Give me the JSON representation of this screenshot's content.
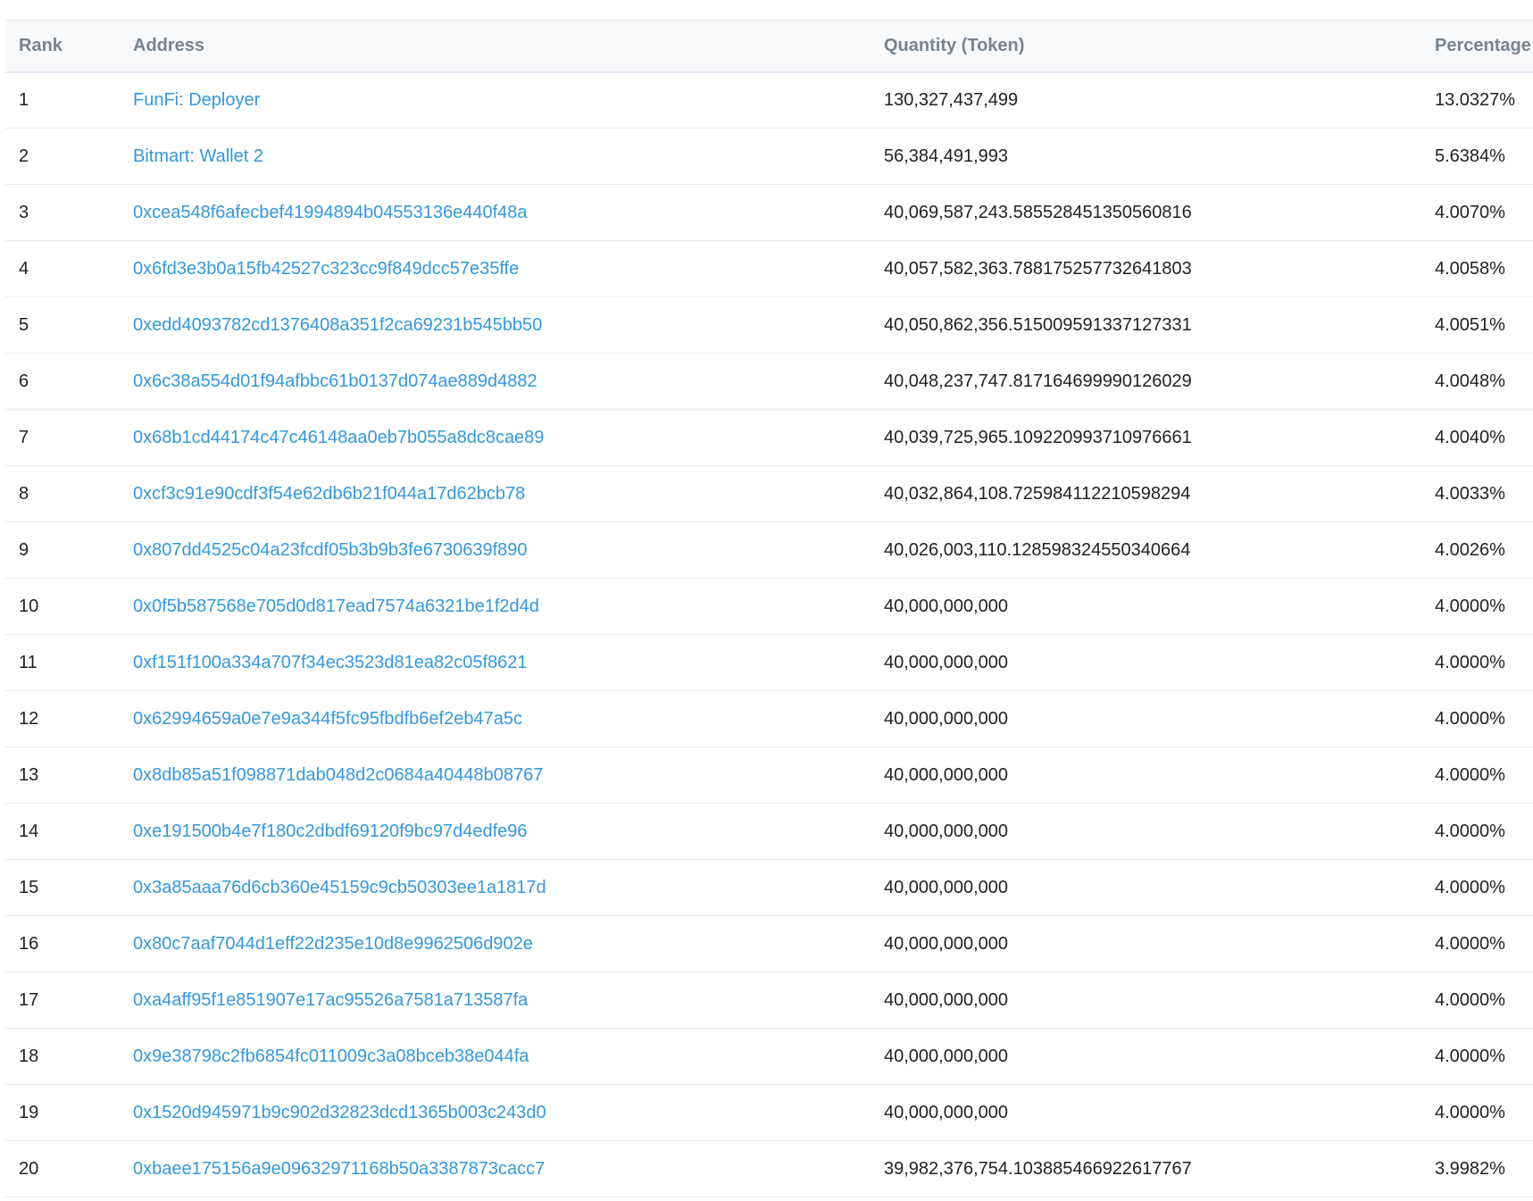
{
  "table": {
    "headers": {
      "rank": "Rank",
      "address": "Address",
      "quantity": "Quantity (Token)",
      "percentage": "Percentage"
    },
    "rows": [
      {
        "rank": "1",
        "address": "FunFi: Deployer",
        "quantity": "130,327,437,499",
        "percentage": "13.0327%"
      },
      {
        "rank": "2",
        "address": "Bitmart: Wallet 2",
        "quantity": "56,384,491,993",
        "percentage": "5.6384%"
      },
      {
        "rank": "3",
        "address": "0xcea548f6afecbef41994894b04553136e440f48a",
        "quantity": "40,069,587,243.585528451350560816",
        "percentage": "4.0070%"
      },
      {
        "rank": "4",
        "address": "0x6fd3e3b0a15fb42527c323cc9f849dcc57e35ffe",
        "quantity": "40,057,582,363.788175257732641803",
        "percentage": "4.0058%"
      },
      {
        "rank": "5",
        "address": "0xedd4093782cd1376408a351f2ca69231b545bb50",
        "quantity": "40,050,862,356.515009591337127331",
        "percentage": "4.0051%"
      },
      {
        "rank": "6",
        "address": "0x6c38a554d01f94afbbc61b0137d074ae889d4882",
        "quantity": "40,048,237,747.817164699990126029",
        "percentage": "4.0048%"
      },
      {
        "rank": "7",
        "address": "0x68b1cd44174c47c46148aa0eb7b055a8dc8cae89",
        "quantity": "40,039,725,965.109220993710976661",
        "percentage": "4.0040%"
      },
      {
        "rank": "8",
        "address": "0xcf3c91e90cdf3f54e62db6b21f044a17d62bcb78",
        "quantity": "40,032,864,108.725984112210598294",
        "percentage": "4.0033%"
      },
      {
        "rank": "9",
        "address": "0x807dd4525c04a23fcdf05b3b9b3fe6730639f890",
        "quantity": "40,026,003,110.128598324550340664",
        "percentage": "4.0026%"
      },
      {
        "rank": "10",
        "address": "0x0f5b587568e705d0d817ead7574a6321be1f2d4d",
        "quantity": "40,000,000,000",
        "percentage": "4.0000%"
      },
      {
        "rank": "11",
        "address": "0xf151f100a334a707f34ec3523d81ea82c05f8621",
        "quantity": "40,000,000,000",
        "percentage": "4.0000%"
      },
      {
        "rank": "12",
        "address": "0x62994659a0e7e9a344f5fc95fbdfb6ef2eb47a5c",
        "quantity": "40,000,000,000",
        "percentage": "4.0000%"
      },
      {
        "rank": "13",
        "address": "0x8db85a51f098871dab048d2c0684a40448b08767",
        "quantity": "40,000,000,000",
        "percentage": "4.0000%"
      },
      {
        "rank": "14",
        "address": "0xe191500b4e7f180c2dbdf69120f9bc97d4edfe96",
        "quantity": "40,000,000,000",
        "percentage": "4.0000%"
      },
      {
        "rank": "15",
        "address": "0x3a85aaa76d6cb360e45159c9cb50303ee1a1817d",
        "quantity": "40,000,000,000",
        "percentage": "4.0000%"
      },
      {
        "rank": "16",
        "address": "0x80c7aaf7044d1eff22d235e10d8e9962506d902e",
        "quantity": "40,000,000,000",
        "percentage": "4.0000%"
      },
      {
        "rank": "17",
        "address": "0xa4aff95f1e851907e17ac95526a7581a713587fa",
        "quantity": "40,000,000,000",
        "percentage": "4.0000%"
      },
      {
        "rank": "18",
        "address": "0x9e38798c2fb6854fc011009c3a08bceb38e044fa",
        "quantity": "40,000,000,000",
        "percentage": "4.0000%"
      },
      {
        "rank": "19",
        "address": "0x1520d945971b9c902d32823dcd1365b003c243d0",
        "quantity": "40,000,000,000",
        "percentage": "4.0000%"
      },
      {
        "rank": "20",
        "address": "0xbaee175156a9e09632971168b50a3387873cacc7",
        "quantity": "39,982,376,754.103885466922617767",
        "percentage": "3.9982%"
      }
    ]
  },
  "colors": {
    "link": "#3498db",
    "header_text": "#77838f",
    "border": "#e7eaf3",
    "body_text": "#1e2022"
  }
}
